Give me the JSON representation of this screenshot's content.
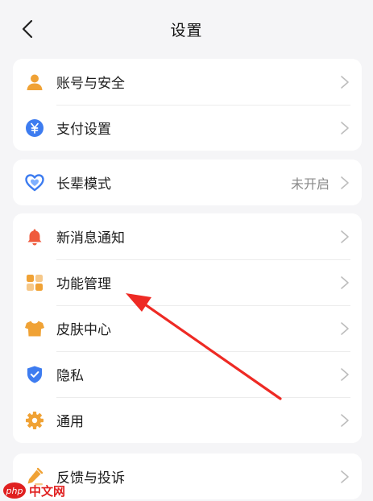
{
  "header": {
    "title": "设置"
  },
  "groups": [
    {
      "rows": [
        {
          "icon": "user-icon",
          "label": "账号与安全"
        },
        {
          "icon": "yen-icon",
          "label": "支付设置"
        }
      ]
    },
    {
      "rows": [
        {
          "icon": "heart-shield-icon",
          "label": "长辈模式",
          "value": "未开启"
        }
      ]
    },
    {
      "rows": [
        {
          "icon": "bell-icon",
          "label": "新消息通知"
        },
        {
          "icon": "grid-icon",
          "label": "功能管理"
        },
        {
          "icon": "tshirt-icon",
          "label": "皮肤中心"
        },
        {
          "icon": "shield-check-icon",
          "label": "隐私"
        },
        {
          "icon": "gear-icon",
          "label": "通用"
        }
      ]
    },
    {
      "rows": [
        {
          "icon": "pencil-icon",
          "label": "反馈与投诉"
        }
      ]
    }
  ],
  "colors": {
    "accent_orange": "#f0a235",
    "accent_blue": "#3d7cf0",
    "accent_red": "#ef5a3c",
    "annotation_arrow": "#ee2a24"
  },
  "watermark": {
    "logo_text": "php",
    "text": "中文网"
  }
}
